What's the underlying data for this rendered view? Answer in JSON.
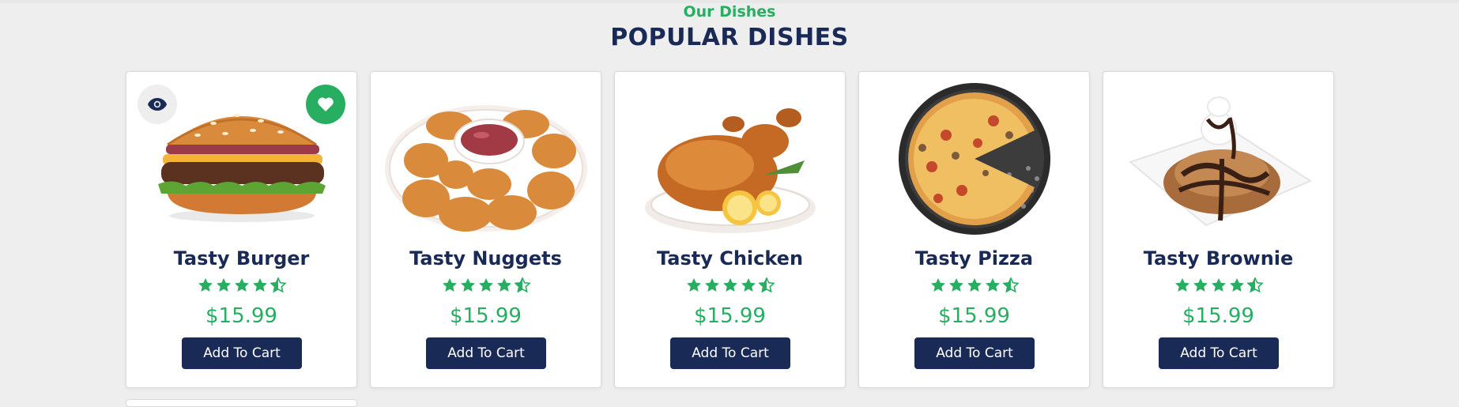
{
  "section": {
    "eyebrow": "Our Dishes",
    "title": "POPULAR DISHES"
  },
  "colors": {
    "accent_green": "#27ae60",
    "navy": "#192a56",
    "background": "#eeeeee"
  },
  "dishes": [
    {
      "name": "Tasty Burger",
      "price": "$15.99",
      "rating": 4.5,
      "button": "Add To Cart",
      "image_icon": "burger-icon"
    },
    {
      "name": "Tasty Nuggets",
      "price": "$15.99",
      "rating": 4.5,
      "button": "Add To Cart",
      "image_icon": "nuggets-icon"
    },
    {
      "name": "Tasty Chicken",
      "price": "$15.99",
      "rating": 4.5,
      "button": "Add To Cart",
      "image_icon": "roast-chicken-icon"
    },
    {
      "name": "Tasty Pizza",
      "price": "$15.99",
      "rating": 4.5,
      "button": "Add To Cart",
      "image_icon": "pizza-icon"
    },
    {
      "name": "Tasty Brownie",
      "price": "$15.99",
      "rating": 4.5,
      "button": "Add To Cart",
      "image_icon": "brownie-icon"
    }
  ],
  "card_actions": {
    "view_icon": "eye-icon",
    "favorite_icon": "heart-icon"
  }
}
